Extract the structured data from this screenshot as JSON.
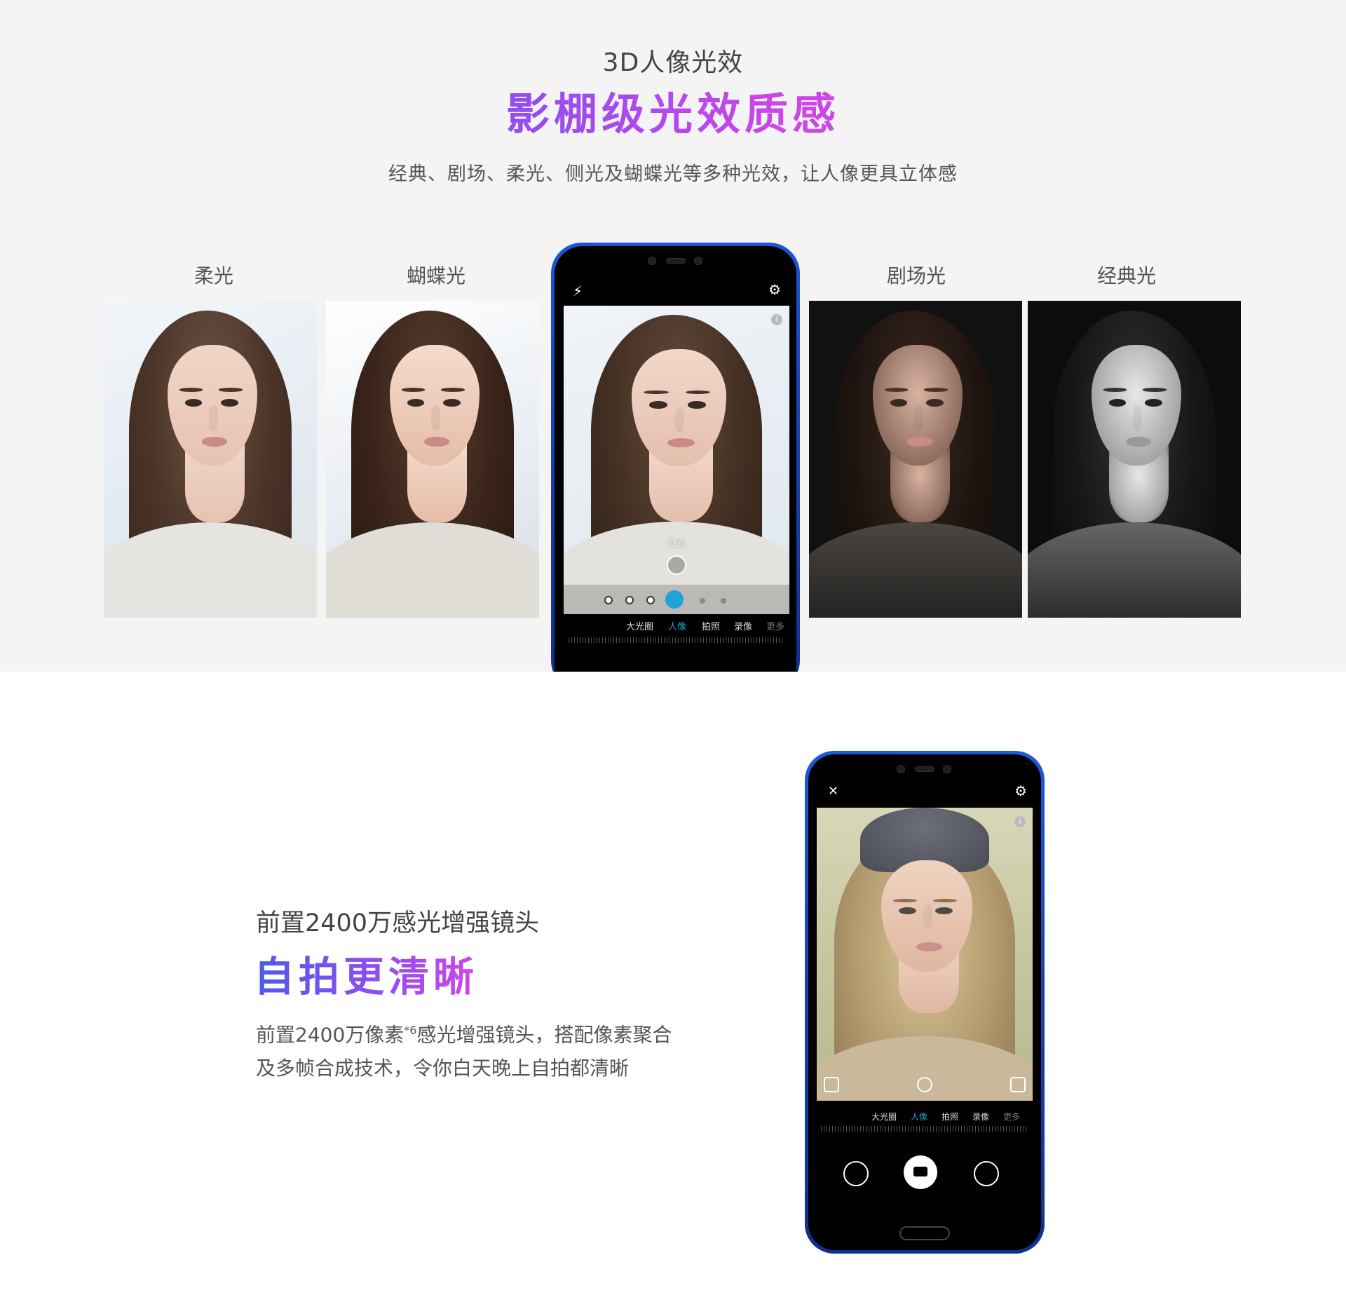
{
  "section1": {
    "subtitle": "3D人像光效",
    "title": "影棚级光效质感",
    "description": "经典、剧场、柔光、侧光及蝴蝶光等多种光效，让人像更具立体感",
    "photos": [
      {
        "label": "柔光"
      },
      {
        "label": "蝴蝶光"
      },
      {
        "label": "剧场光"
      },
      {
        "label": "经典光"
      }
    ],
    "phone": {
      "effect_label": "侧光",
      "info_icon": "i",
      "modes": [
        "大光圈",
        "人像",
        "拍照",
        "录像",
        "更多"
      ],
      "active_mode": "人像"
    }
  },
  "section2": {
    "subtitle": "前置2400万感光增强镜头",
    "title": "自拍更清晰",
    "description_line1_a": "前置2400万像素",
    "description_sup": "*6",
    "description_line1_b": "感光增强镜头，搭配像素聚合",
    "description_line2": "及多帧合成技术，令你白天晚上自拍都清晰",
    "phone": {
      "info_icon": "i",
      "modes": [
        "大光圈",
        "人像",
        "拍照",
        "录像",
        "更多"
      ],
      "active_mode": "人像"
    }
  },
  "colors": {
    "background_top": "#f4f4f4",
    "accent_blue": "#1fa3d8",
    "phone_body": "#1b55d6"
  }
}
